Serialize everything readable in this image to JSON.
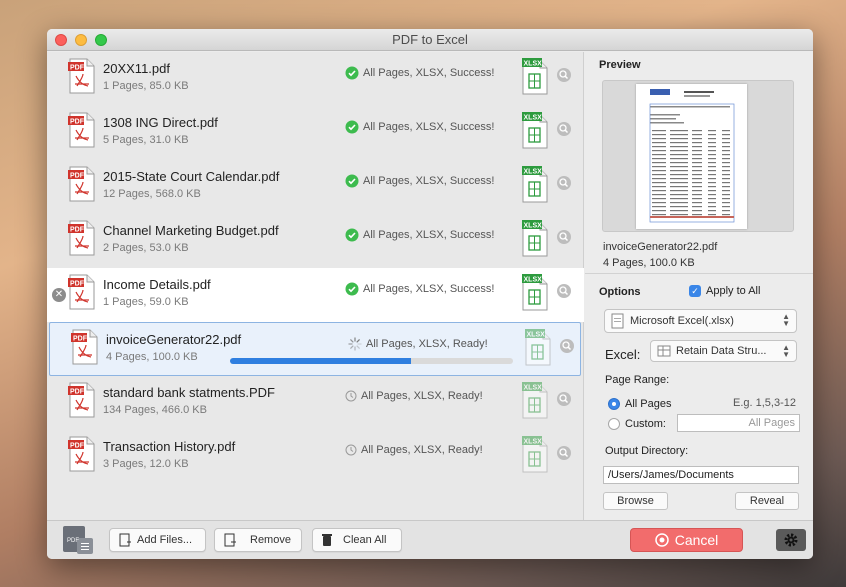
{
  "window": {
    "title": "PDF to Excel"
  },
  "files": [
    {
      "name": "20XX11.pdf",
      "meta": "1 Pages, 85.0 KB",
      "status": "All Pages, XLSX, Success!",
      "state": "success"
    },
    {
      "name": "1308 ING Direct.pdf",
      "meta": "5 Pages, 31.0 KB",
      "status": "All Pages, XLSX, Success!",
      "state": "success"
    },
    {
      "name": "2015-State Court Calendar.pdf",
      "meta": "12 Pages, 568.0 KB",
      "status": "All Pages, XLSX, Success!",
      "state": "success"
    },
    {
      "name": "Channel Marketing Budget.pdf",
      "meta": "2 Pages, 53.0 KB",
      "status": "All Pages, XLSX, Success!",
      "state": "success"
    },
    {
      "name": "Income Details.pdf",
      "meta": "1 Pages, 59.0 KB",
      "status": "All Pages, XLSX, Success!",
      "state": "success"
    },
    {
      "name": "invoiceGenerator22.pdf",
      "meta": "4 Pages, 100.0 KB",
      "status": "All Pages, XLSX, Ready!",
      "state": "converting",
      "progress": 0.64
    },
    {
      "name": "standard bank statments.PDF",
      "meta": "134 Pages, 466.0 KB",
      "status": "All Pages, XLSX, Ready!",
      "state": "ready"
    },
    {
      "name": "Transaction History.pdf",
      "meta": "3 Pages, 12.0 KB",
      "status": "All Pages, XLSX, Ready!",
      "state": "ready"
    }
  ],
  "toolbar": {
    "add_files": "Add Files...",
    "remove": "Remove",
    "clean_all": "Clean All",
    "cancel": "Cancel"
  },
  "preview": {
    "title": "Preview",
    "file_name": "invoiceGenerator22.pdf",
    "file_meta": "4 Pages, 100.0 KB"
  },
  "options": {
    "title": "Options",
    "apply_to_all": "Apply to All",
    "format_select": "Microsoft Excel(.xlsx)",
    "excel_label": "Excel:",
    "excel_mode": "Retain Data Stru...",
    "page_range_label": "Page Range:",
    "all_pages": "All Pages",
    "example": "E.g. 1,5,3-12",
    "custom": "Custom:",
    "custom_placeholder": "All Pages",
    "output_label": "Output Directory:",
    "output_path": "/Users/James/Documents",
    "browse": "Browse",
    "reveal": "Reveal"
  },
  "colors": {
    "accent": "#2f7fe0",
    "success": "#3dbb4e",
    "cancel": "#f26c6c"
  }
}
